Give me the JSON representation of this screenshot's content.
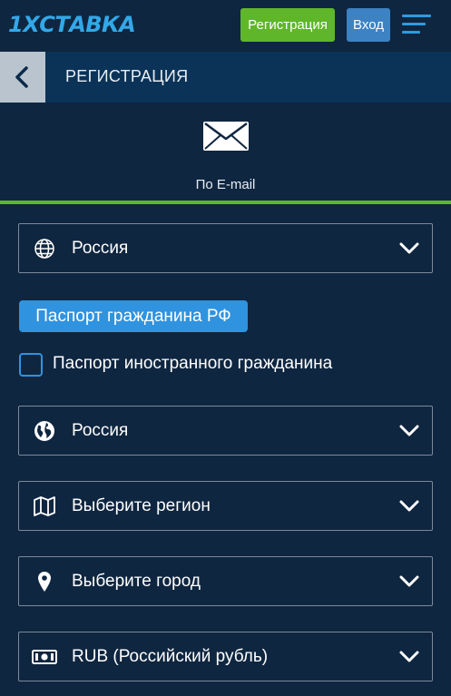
{
  "topbar": {
    "logo": "1XСТАВКА",
    "register_label": "Регистрация",
    "login_label": "Вход"
  },
  "header": {
    "title": "РЕГИСТРАЦИЯ"
  },
  "tab": {
    "label": "По E-mail"
  },
  "form": {
    "country_select": "Россия",
    "passport_rf_label": "Паспорт гражданина РФ",
    "foreign_passport_label": "Паспорт иностранного гражданина",
    "foreign_passport_checked": false,
    "citizenship_select": "Россия",
    "region_select": "Выберите регион",
    "city_select": "Выберите город",
    "currency_select": "RUB (Российский рубль)"
  },
  "colors": {
    "background": "#0f2640",
    "header": "#0b3358",
    "green": "#5fb62a",
    "blue": "#3d82c2",
    "accent": "#2f93e0"
  },
  "icons": {
    "menu": "hamburger-icon",
    "back": "chevron-left-icon",
    "email": "envelope-icon",
    "country": "globe-outline-icon",
    "citizenship": "globe-filled-icon",
    "region": "map-icon",
    "city": "map-pin-icon",
    "currency": "banknote-icon",
    "dropdown": "chevron-down-icon"
  }
}
